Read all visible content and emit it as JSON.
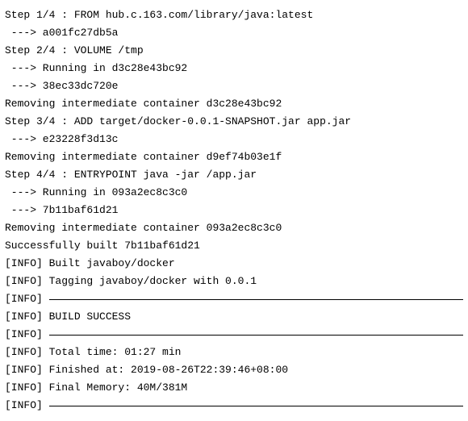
{
  "lines": {
    "l1": "Step 1/4 : FROM hub.c.163.com/library/java:latest",
    "l2": " ---> a001fc27db5a",
    "l3": "Step 2/4 : VOLUME /tmp",
    "l4": " ---> Running in d3c28e43bc92",
    "l5": " ---> 38ec33dc720e",
    "l6": "Removing intermediate container d3c28e43bc92",
    "l7": "Step 3/4 : ADD target/docker-0.0.1-SNAPSHOT.jar app.jar",
    "l8": " ---> e23228f3d13c",
    "l9": "Removing intermediate container d9ef74b03e1f",
    "l10": "Step 4/4 : ENTRYPOINT java -jar /app.jar",
    "l11": " ---> Running in 093a2ec8c3c0",
    "l12": " ---> 7b11baf61d21",
    "l13": "Removing intermediate container 093a2ec8c3c0",
    "l14": "Successfully built 7b11baf61d21",
    "l15": "[INFO] Built javaboy/docker",
    "l16": "[INFO] Tagging javaboy/docker with 0.0.1",
    "l17_prefix": "[INFO] ",
    "l18": "[INFO] BUILD SUCCESS",
    "l19_prefix": "[INFO] ",
    "l20": "[INFO] Total time: 01:27 min",
    "l21": "[INFO] Finished at: 2019-08-26T22:39:46+08:00",
    "l22": "[INFO] Final Memory: 40M/381M",
    "l23_prefix": "[INFO] "
  }
}
